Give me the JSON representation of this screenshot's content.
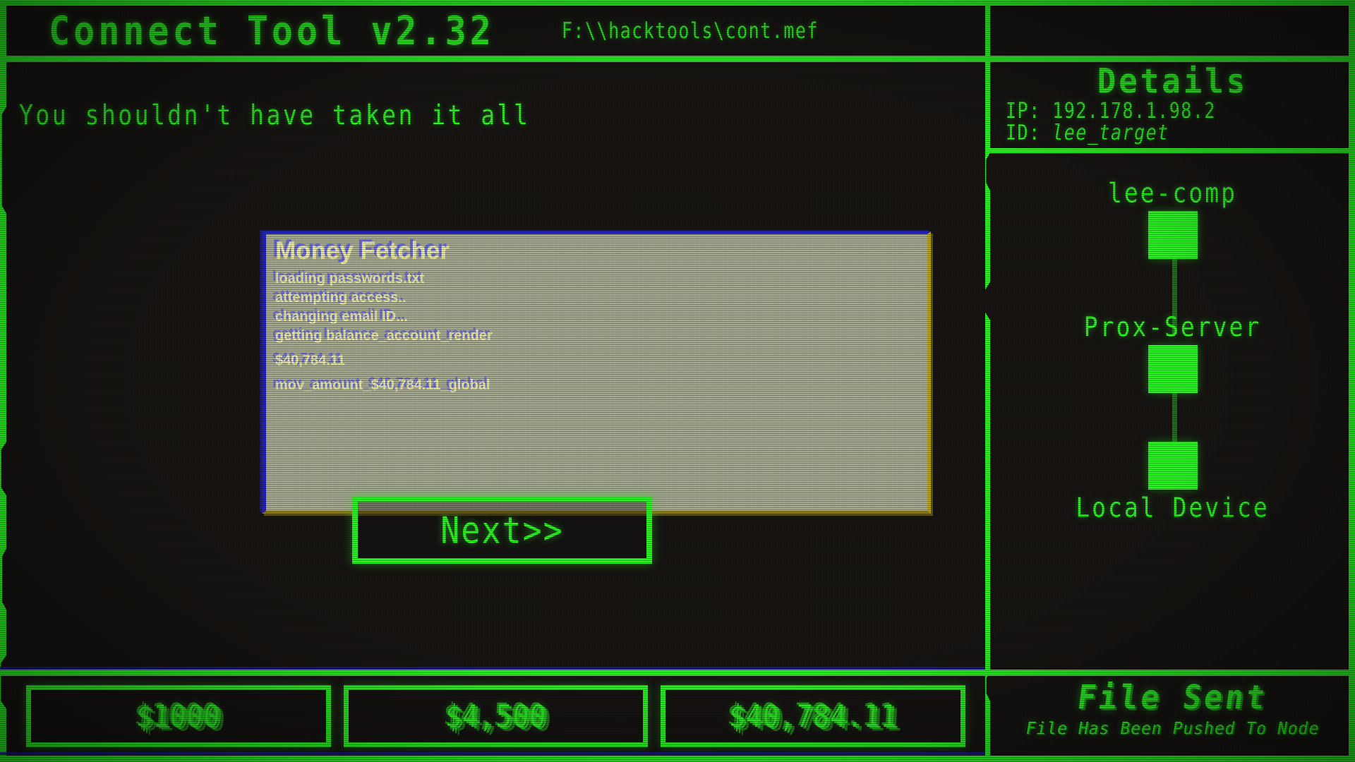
{
  "window": {
    "title": "Connect Tool v2.32",
    "path": "F:\\\\hacktools\\cont.mef"
  },
  "terminal": {
    "message": "You shouldn't have taken it all"
  },
  "dialog": {
    "title": "Money Fetcher",
    "log_lines": [
      "loading passwords.txt",
      "attempting access..",
      "changing email ID...",
      "getting balance_account_render",
      "$40,784.11",
      "mov_amount_$40,784.11_global"
    ]
  },
  "actions": {
    "next_label": "Next>>"
  },
  "details": {
    "title": "Details",
    "ip_label": "IP:",
    "ip_value": "192.178.1.98.2",
    "id_label": "ID:",
    "id_value": "lee_target"
  },
  "network": {
    "nodes": [
      {
        "label": "lee-comp",
        "label_position": "above"
      },
      {
        "label": "Prox-Server",
        "label_position": "above"
      },
      {
        "label": "Local Device",
        "label_position": "below"
      }
    ]
  },
  "money_bar": {
    "boxes": [
      {
        "value": "$1000"
      },
      {
        "value": "$4,500"
      },
      {
        "value": "$40,784.11"
      }
    ]
  },
  "file_status": {
    "title": "File Sent",
    "subtitle": "File Has Been Pushed To Node"
  },
  "colors": {
    "terminal_green": "#2bf423",
    "dim_green": "#1d6f19",
    "background": "#151211",
    "dialog_bg": "#a9ad94",
    "dialog_border_blue": "#2222b8",
    "dialog_border_yellow": "#b8a318",
    "dialog_text": "#f6f4ae",
    "ghost_blue": "#5a5aeb"
  }
}
